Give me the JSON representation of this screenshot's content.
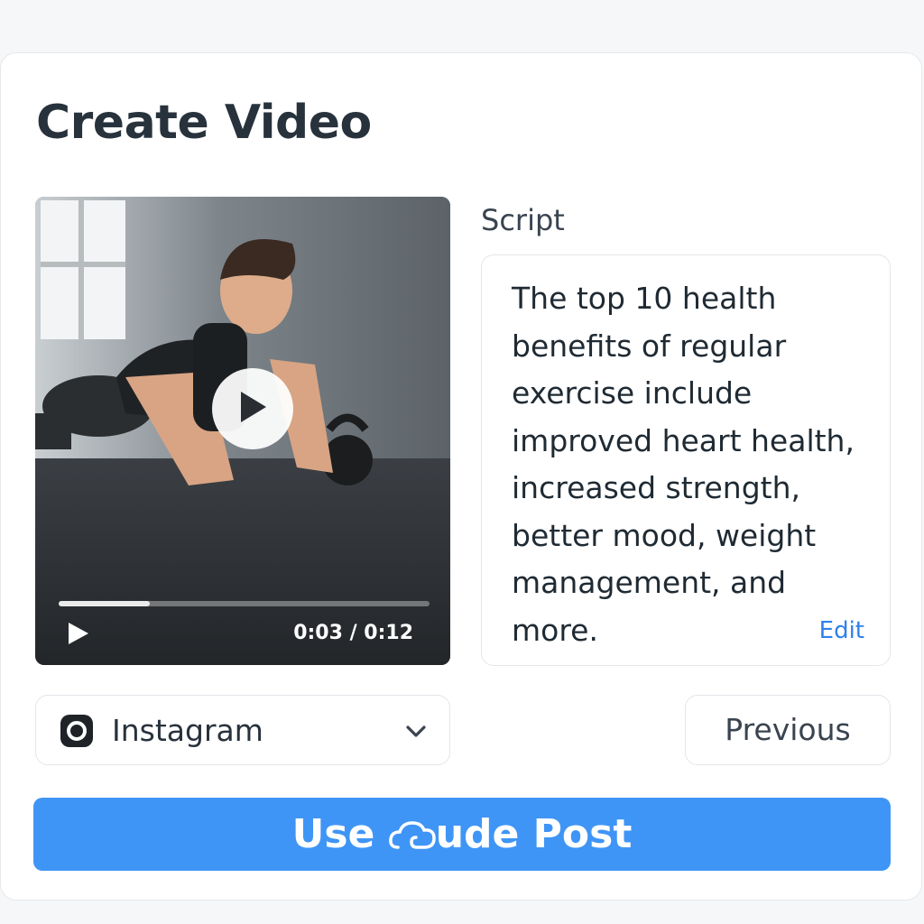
{
  "page": {
    "title": "Create Video"
  },
  "video": {
    "current_time": "0:03",
    "duration": "0:12",
    "time_display": "0:03 / 0:12",
    "progress": 0.245
  },
  "script": {
    "label": "Script",
    "text": "The top 10 health benefits of regular exercise include improved heart health, increased strength, better mood, weight management, and more.",
    "edit_label": "Edit"
  },
  "platform_select": {
    "selected": "Instagram",
    "icon": "instagram-icon"
  },
  "buttons": {
    "previous_label": "Previous",
    "primary_label_before": "Use ",
    "primary_label_after": "ude Post",
    "primary_icon": "cloud-icon"
  },
  "colors": {
    "primary": "#3f95f6",
    "link": "#2f80ed",
    "title": "#28323c"
  }
}
